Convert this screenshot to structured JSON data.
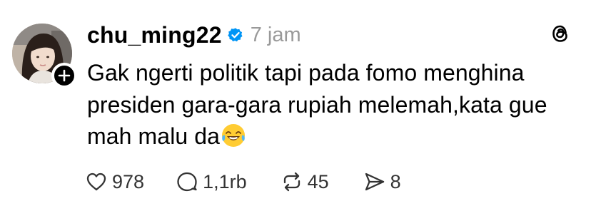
{
  "post": {
    "username": "chu_ming22",
    "verified": true,
    "time_ago": "7 jam",
    "text_lines": [
      "Gak ngerti politik tapi pada fomo menghina",
      "presiden gara-gara rupiah melemah,kata gue",
      "mah malu da"
    ],
    "trailing_emoji": "😂",
    "counts": {
      "likes": "978",
      "replies": "1,1rb",
      "reposts": "45",
      "shares": "8"
    }
  },
  "icons": {
    "verified": "verified-badge-icon",
    "app_logo": "threads-logo-icon",
    "follow": "plus-icon",
    "like": "heart-icon",
    "reply": "comment-icon",
    "repost": "repost-icon",
    "share": "send-icon"
  },
  "colors": {
    "verified_blue": "#0095f6",
    "text": "#000000",
    "muted": "#999999",
    "counts": "#333333"
  }
}
